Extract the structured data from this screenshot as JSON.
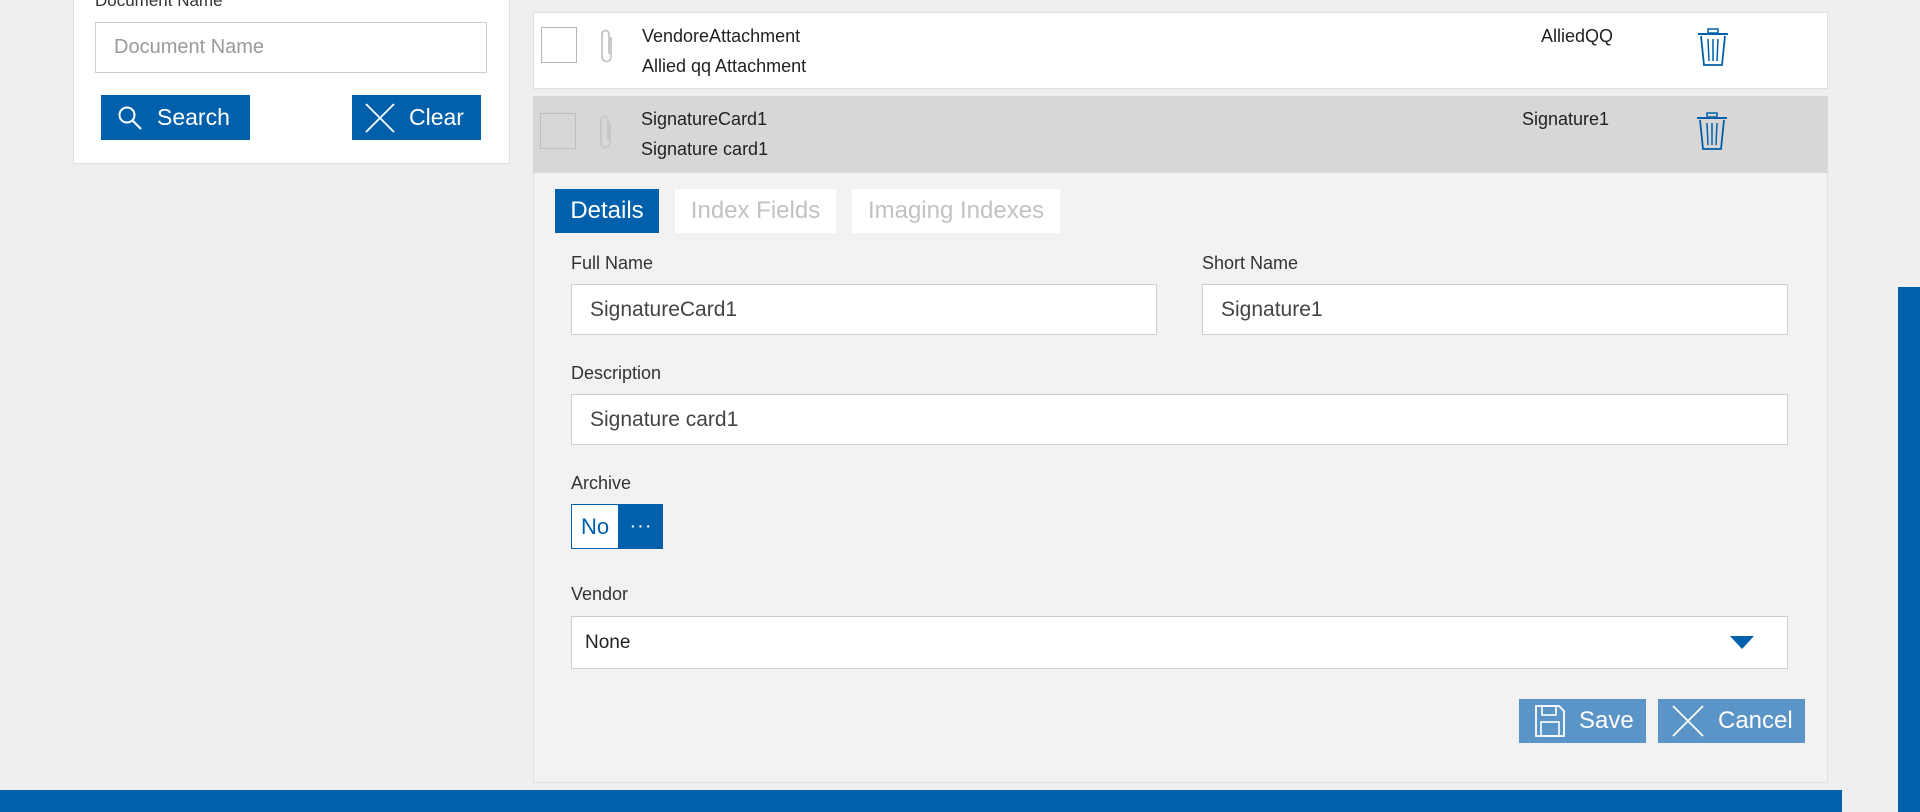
{
  "filter": {
    "document_name_label": "Document Name",
    "document_name_placeholder": "Document Name",
    "document_name_value": "",
    "search_label": "Search",
    "clear_label": "Clear"
  },
  "rows": [
    {
      "name": "VendoreAttachment",
      "description": "Allied qq Attachment",
      "short_name": "AlliedQQ",
      "checked": false,
      "selected": false
    },
    {
      "name": "SignatureCard1",
      "description": "Signature card1",
      "short_name": "Signature1",
      "checked": false,
      "selected": true
    }
  ],
  "detail": {
    "tabs": [
      {
        "label": "Details",
        "active": true
      },
      {
        "label": "Index Fields",
        "active": false
      },
      {
        "label": "Imaging Indexes",
        "active": false
      }
    ],
    "full_name_label": "Full Name",
    "full_name_value": "SignatureCard1",
    "short_name_label": "Short Name",
    "short_name_value": "Signature1",
    "description_label": "Description",
    "description_value": "Signature card1",
    "archive_label": "Archive",
    "archive_value": "No",
    "archive_more": "···",
    "vendor_label": "Vendor",
    "vendor_value": "None",
    "save_label": "Save",
    "cancel_label": "Cancel"
  },
  "colors": {
    "primary": "#0060ab",
    "disabled_button": "#5b95c8",
    "selected_row": "#d7d7d7",
    "background": "#efefef"
  }
}
